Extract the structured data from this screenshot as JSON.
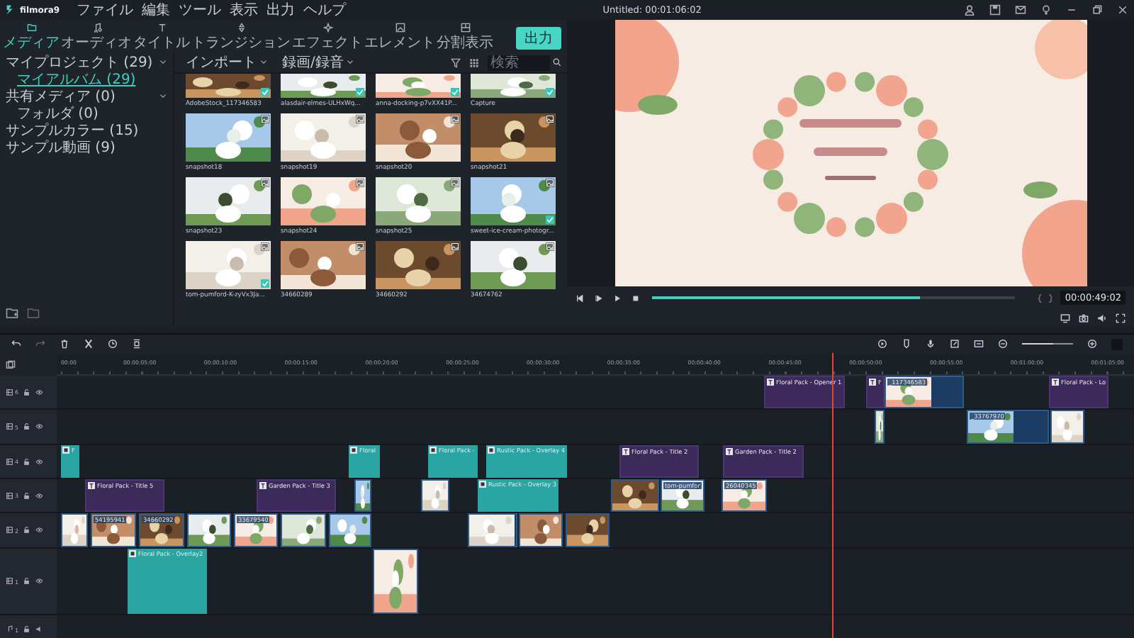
{
  "app": {
    "logo": "filmora9",
    "menu": [
      "ファイル",
      "編集",
      "ツール",
      "表示",
      "出力",
      "ヘルプ"
    ],
    "title": "Untitled: 00:01:06:02"
  },
  "tabs": [
    {
      "label": "メディア",
      "selected": true
    },
    {
      "label": "オーディオ",
      "selected": false
    },
    {
      "label": "タイトル",
      "selected": false
    },
    {
      "label": "トランジション",
      "selected": false
    },
    {
      "label": "エフェクト",
      "selected": false
    },
    {
      "label": "エレメント",
      "selected": false
    },
    {
      "label": "分割表示",
      "selected": false
    }
  ],
  "export_button": "出力",
  "sidebar": {
    "items": [
      {
        "label": "マイプロジェクト (29)",
        "selected": false,
        "expanded": true,
        "children": [
          {
            "label": "マイアルバム (29)",
            "selected": true
          }
        ]
      },
      {
        "label": "共有メディア (0)",
        "selected": false,
        "expanded": true,
        "children": [
          {
            "label": "フォルダ (0)",
            "selected": false
          }
        ]
      },
      {
        "label": "サンプルカラー (15)",
        "selected": false
      },
      {
        "label": "サンプル動画 (9)",
        "selected": false
      }
    ]
  },
  "media_toolbar": {
    "import": "インポート",
    "record": "録画/録音",
    "search": {
      "placeholder": "検索"
    }
  },
  "media": [
    {
      "name": "AdobeStock_117346583",
      "checked": true
    },
    {
      "name": "alasdair-elmes-ULHxWq...",
      "checked": true
    },
    {
      "name": "anna-docking-p7vXX41P...",
      "checked": true
    },
    {
      "name": "Capture",
      "checked": true
    },
    {
      "name": "snapshot18",
      "checked": false
    },
    {
      "name": "snapshot19",
      "checked": false
    },
    {
      "name": "snapshot20",
      "checked": false
    },
    {
      "name": "snapshot21",
      "checked": false
    },
    {
      "name": "snapshot23",
      "checked": false
    },
    {
      "name": "snapshot24",
      "checked": false
    },
    {
      "name": "snapshot25",
      "checked": false
    },
    {
      "name": "sweet-ice-cream-photogr...",
      "checked": true
    },
    {
      "name": "tom-pumford-K-zyVx3Ja...",
      "checked": true
    },
    {
      "name": "34660289",
      "checked": false
    },
    {
      "name": "34660292",
      "checked": false
    },
    {
      "name": "34674762",
      "checked": false
    }
  ],
  "preview": {
    "level": 0.74,
    "timecode": "00:00:49:02"
  },
  "timeline": {
    "zoom": {
      "level": 0.6
    },
    "ruler": [
      "00:00",
      "00:00:05:00",
      "00:00:10:00",
      "00:00:15:00",
      "00:00:20:00",
      "00:00:25:00",
      "00:00:30:00",
      "00:00:35:00",
      "00:00:40:00",
      "00:00:45:00",
      "00:00:50:00",
      "00:00:55:00",
      "00:01:00:00",
      "00:01:05:00"
    ],
    "tracks": [
      {
        "label": "6",
        "kind": "video",
        "clips": [
          {
            "kind": "title",
            "label": "Floral Pack - Opener 1"
          },
          {
            "kind": "title",
            "label": "F"
          },
          {
            "kind": "video",
            "label": "_117346583"
          },
          {
            "kind": "title",
            "label": "Floral Pack - Lo"
          }
        ]
      },
      {
        "label": "5",
        "kind": "video",
        "clips": [
          {
            "kind": "video"
          },
          {
            "kind": "video",
            "label": "_33767970"
          },
          {
            "kind": "video"
          }
        ]
      },
      {
        "label": "4",
        "kind": "video",
        "clips": [
          {
            "kind": "overlay",
            "label": "F"
          },
          {
            "kind": "overlay",
            "label": "Floral"
          },
          {
            "kind": "overlay",
            "label": "Floral Pack -"
          },
          {
            "kind": "overlay",
            "label": "Rustic Pack - Overlay 4"
          },
          {
            "kind": "title",
            "label": "Floral Pack - Title 2"
          },
          {
            "kind": "title",
            "label": "Garden Pack - Title 2"
          }
        ]
      },
      {
        "label": "3",
        "kind": "video",
        "clips": [
          {
            "kind": "title",
            "label": "Floral Pack - Title 5"
          },
          {
            "kind": "title",
            "label": "Garden Pack - Title 3"
          },
          {
            "kind": "video"
          },
          {
            "kind": "video"
          },
          {
            "kind": "overlay",
            "label": "Rustic Pack - Overlay 3"
          },
          {
            "kind": "video"
          },
          {
            "kind": "video",
            "label": "tom-pumfor"
          },
          {
            "kind": "video",
            "label": "26040345"
          }
        ]
      },
      {
        "label": "2",
        "kind": "video",
        "clips": [
          {
            "kind": "video"
          },
          {
            "kind": "video",
            "label": "54195941"
          },
          {
            "kind": "video",
            "label": "34660292"
          },
          {
            "kind": "video"
          },
          {
            "kind": "video",
            "label": "33679540"
          },
          {
            "kind": "video"
          },
          {
            "kind": "video"
          },
          {
            "kind": "video"
          },
          {
            "kind": "video"
          },
          {
            "kind": "video"
          }
        ]
      },
      {
        "label": "1",
        "kind": "video",
        "clips": [
          {
            "kind": "overlay",
            "label": "Floral Pack - Overlay2"
          },
          {
            "kind": "video"
          }
        ]
      },
      {
        "label": "1",
        "kind": "audio"
      }
    ]
  }
}
